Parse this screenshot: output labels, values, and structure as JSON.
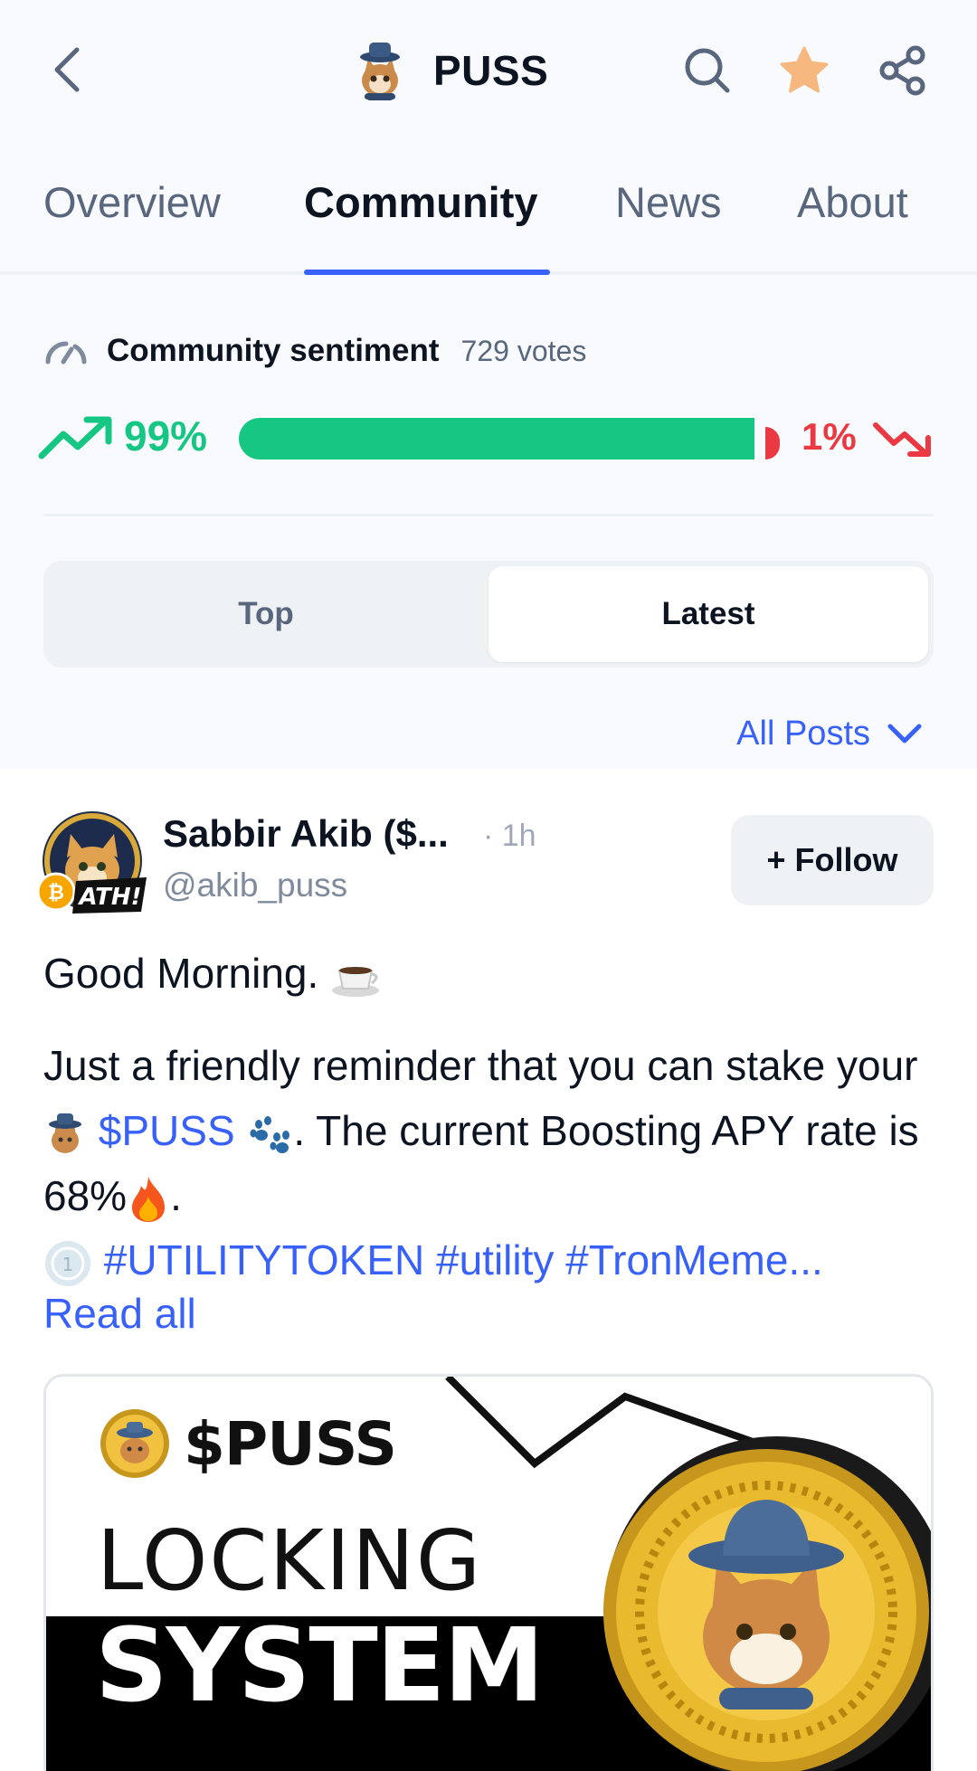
{
  "header": {
    "title": "PUSS",
    "icons": [
      "back-icon",
      "search-icon",
      "star-icon",
      "share-icon"
    ],
    "star_color": "#f6b87e"
  },
  "tabs": [
    {
      "label": "Overview"
    },
    {
      "label": "Community"
    },
    {
      "label": "News"
    },
    {
      "label": "About"
    }
  ],
  "active_tab": "Community",
  "sentiment": {
    "label": "Community sentiment",
    "votes": "729 votes",
    "bullish_pct": "99%",
    "bearish_pct": "1%",
    "bullish_fraction": 0.99,
    "bull_color": "#16c784",
    "bear_color": "#ea3943"
  },
  "segment": {
    "options": [
      "Top",
      "Latest"
    ],
    "selected": "Latest"
  },
  "filter": {
    "label": "All Posts"
  },
  "post": {
    "author": "Sabbir Akib ($...",
    "time": "· 1h",
    "handle": "@akib_puss",
    "badge": "ATH!",
    "follow_label": "+ Follow",
    "line1": "Good Morning.",
    "body_a": "Just a friendly reminder that you can stake your",
    "body_link": "$PUSS",
    "body_b": ". The current Boosting APY rate is 68%",
    "body_c": ".",
    "tags": "#UTILITYTOKEN #utility #TronMeme...",
    "read_all": "Read all",
    "image": {
      "brand": "$PUSS",
      "line1": "LOCKING",
      "line2": "SYSTEM"
    }
  }
}
